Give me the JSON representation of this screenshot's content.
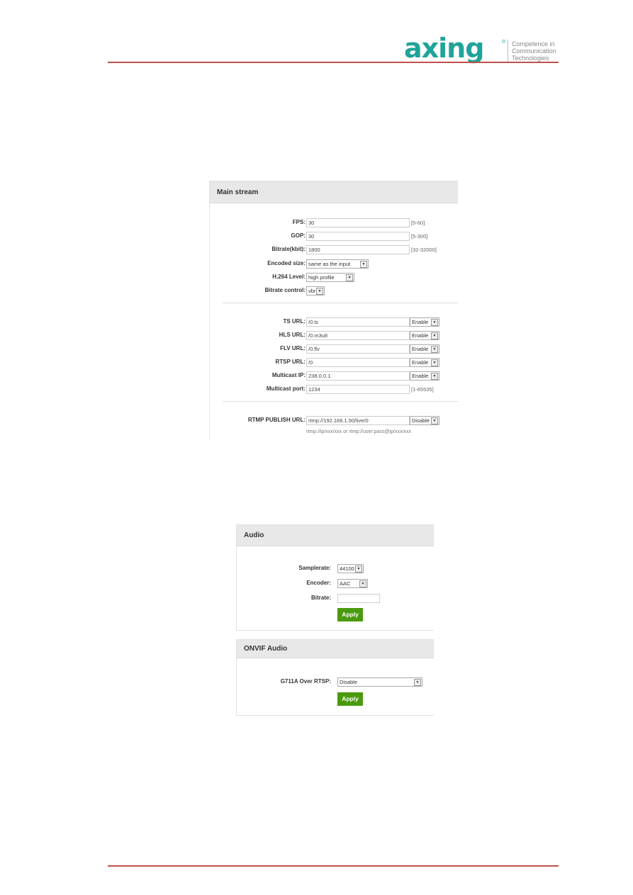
{
  "brand": {
    "name": "axing",
    "tagline": [
      "Competence in",
      "Communication",
      "Technologies"
    ],
    "color": "#1fa39a",
    "rule_color": "#c0504d"
  },
  "main_stream": {
    "title": "Main stream",
    "video": [
      {
        "label": "FPS:",
        "value": "30",
        "range": "[5-60]",
        "type": "input"
      },
      {
        "label": "GOP:",
        "value": "30",
        "range": "[5-300]",
        "type": "input"
      },
      {
        "label": "Bitrate(kbit):",
        "value": "1800",
        "range": "[32-32000]",
        "type": "input"
      },
      {
        "label": "Encoded size:",
        "value": "same as the input",
        "type": "select"
      },
      {
        "label": "H.264 Level:",
        "value": "high profile",
        "type": "select"
      },
      {
        "label": "Bitrate control:",
        "value": "vbr",
        "type": "select"
      }
    ],
    "urls": [
      {
        "label": "TS URL:",
        "value": "/0.ts",
        "state": "Enable"
      },
      {
        "label": "HLS URL:",
        "value": "/0.m3u8",
        "state": "Enable"
      },
      {
        "label": "FLV URL:",
        "value": "/0.flv",
        "state": "Enable"
      },
      {
        "label": "RTSP URL:",
        "value": "/0",
        "state": "Enable"
      },
      {
        "label": "Multicast IP:",
        "value": "238.0.0.1",
        "state": "Enable"
      },
      {
        "label": "Multicast port:",
        "value": "1234",
        "range": "[1-65535]"
      }
    ],
    "rtmp": {
      "label": "RTMP PUBLISH URL:",
      "value": "rtmp://192.168.1.50/live/0",
      "state": "Disable",
      "hint": "rtmp://ip/xxx/xxx or rtmp://user:pass@ip/xxx/xxx"
    }
  },
  "audio": {
    "title": "Audio",
    "samplerate_label": "Samplerate:",
    "samplerate": "44100",
    "encoder_label": "Encoder:",
    "encoder": "AAC",
    "bitrate_label": "Bitrate:",
    "bitrate": "",
    "apply": "Apply",
    "apply_color": "#4a9a0e"
  },
  "onvif_audio": {
    "title": "ONVIF Audio",
    "g711a_label": "G711A Over RTSP:",
    "g711a": "Disable",
    "apply": "Apply"
  }
}
